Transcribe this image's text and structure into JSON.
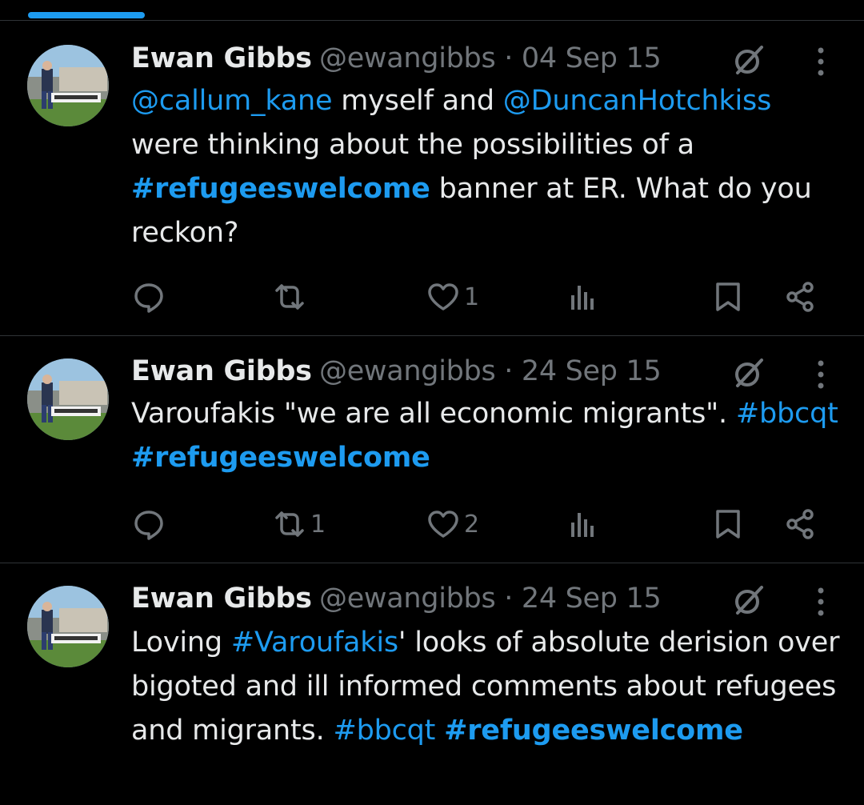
{
  "tweets": [
    {
      "author": {
        "name": "Ewan Gibbs",
        "handle_time": "@ewangibbs · 04 Sep 15"
      },
      "body_segments": [
        {
          "text": "@callum_kane",
          "style": "link"
        },
        {
          "text": " myself and ",
          "style": "plain"
        },
        {
          "text": "@DuncanHotchkiss",
          "style": "link"
        },
        {
          "text": " were thinking about the possibilities of a ",
          "style": "plain"
        },
        {
          "text": "#refugeeswelcome",
          "style": "hash"
        },
        {
          "text": " banner at ER. What do you reckon?",
          "style": "plain"
        }
      ],
      "stats": {
        "replies": "",
        "retweets": "",
        "likes": "1"
      }
    },
    {
      "author": {
        "name": "Ewan Gibbs",
        "handle_time": "@ewangibbs · 24 Sep 15"
      },
      "body_segments": [
        {
          "text": "Varoufakis \"we are all economic migrants\". ",
          "style": "plain"
        },
        {
          "text": "#bbcqt",
          "style": "link"
        },
        {
          "text": " ",
          "style": "plain"
        },
        {
          "text": "#refugeeswelcome",
          "style": "hash"
        }
      ],
      "stats": {
        "replies": "",
        "retweets": "1",
        "likes": "2"
      }
    },
    {
      "author": {
        "name": "Ewan Gibbs",
        "handle_time": "@ewangibbs · 24 Sep 15"
      },
      "body_segments": [
        {
          "text": "Loving ",
          "style": "plain"
        },
        {
          "text": "#Varoufakis",
          "style": "link"
        },
        {
          "text": "' looks of absolute derision over bigoted and ill informed comments about refugees and migrants. ",
          "style": "plain"
        },
        {
          "text": "#bbcqt",
          "style": "link"
        },
        {
          "text": " ",
          "style": "plain"
        },
        {
          "text": "#refugeeswelcome",
          "style": "hash"
        }
      ],
      "stats": {
        "replies": "",
        "retweets": "",
        "likes": ""
      }
    }
  ],
  "icons": {
    "reply": "reply-icon",
    "retweet": "retweet-icon",
    "like": "heart-icon",
    "views": "views-icon",
    "bookmark": "bookmark-icon",
    "share": "share-icon",
    "grok": "grok-icon",
    "more": "more-icon"
  },
  "colors": {
    "background": "#000000",
    "text": "#e7e9ea",
    "muted": "#71767b",
    "accent": "#1d9bf0",
    "divider": "#2f3336"
  }
}
